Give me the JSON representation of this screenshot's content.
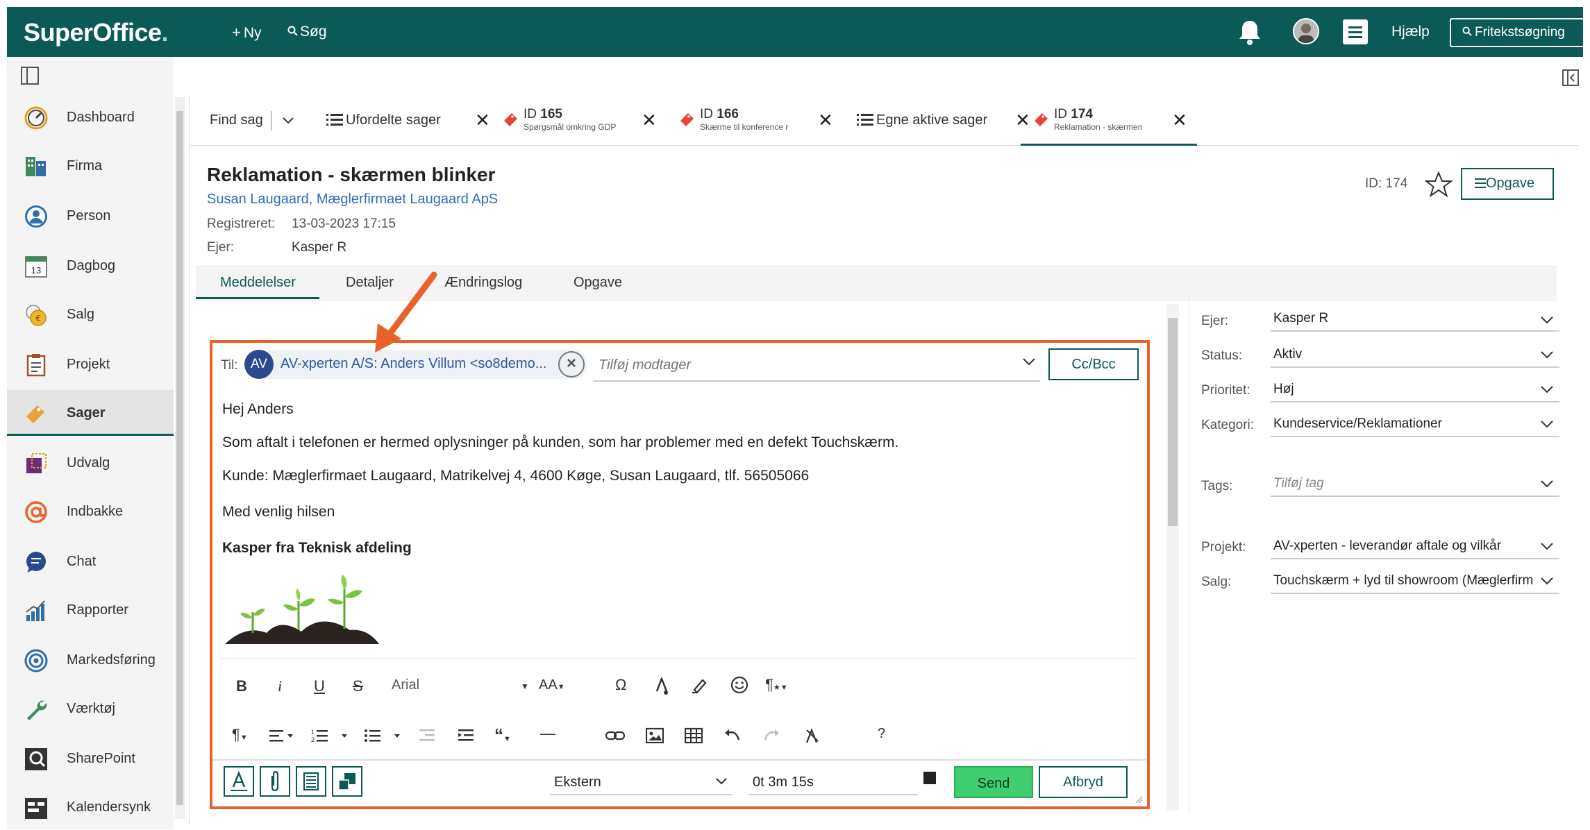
{
  "topbar": {
    "logo": "SuperOffice",
    "logo_dot": ".",
    "new": "Ny",
    "search": "Søg",
    "help": "Hjælp",
    "freetext": "Fritekstsøgning"
  },
  "sidebar": {
    "items": [
      {
        "label": "Dashboard"
      },
      {
        "label": "Firma"
      },
      {
        "label": "Person"
      },
      {
        "label": "Dagbog"
      },
      {
        "label": "Salg"
      },
      {
        "label": "Projekt"
      },
      {
        "label": "Sager"
      },
      {
        "label": "Udvalg"
      },
      {
        "label": "Indbakke"
      },
      {
        "label": "Chat"
      },
      {
        "label": "Rapporter"
      },
      {
        "label": "Markedsføring"
      },
      {
        "label": "Værktøj"
      },
      {
        "label": "SharePoint"
      },
      {
        "label": "Kalendersynk"
      }
    ],
    "calendar_day": "13"
  },
  "tabs": {
    "find": "Find sag",
    "t1": "Ufordelte sager",
    "t2_id": "ID",
    "t2_num": "165",
    "t2_sub": "Spørgsmål omkring GDP",
    "t3_id": "ID",
    "t3_num": "166",
    "t3_sub": "Skærme til konference r",
    "t4": "Egne aktive sager",
    "t5_id": "ID",
    "t5_num": "174",
    "t5_sub": "Reklamation - skærmen"
  },
  "case": {
    "title": "Reklamation - skærmen blinker",
    "contact": "Susan Laugaard, Mæglerfirmaet Laugaard ApS",
    "registered_label": "Registreret:",
    "registered_value": "13-03-2023 17:15",
    "owner_label": "Ejer:",
    "owner_value": "Kasper R",
    "id_text": "ID:  174",
    "opgave": "Opgave"
  },
  "subtabs": [
    "Meddelelser",
    "Detaljer",
    "Ændringslog",
    "Opgave"
  ],
  "editor": {
    "to_label": "Til:",
    "chip_initials": "AV",
    "chip_text": "AV-xperten A/S: Anders Villum <so8demo...",
    "recipient_placeholder": "Tilføj modtager",
    "ccbcc": "Cc/Bcc",
    "greeting": "Hej Anders",
    "line1": "Som aftalt i telefonen er hermed oplysninger på kunden, som har problemer med en defekt Touchskærm.",
    "line2": "Kunde: Mæglerfirmaet Laugaard, Matrikelvej 4, 4600 Køge, Susan Laugaard, tlf. 56505066",
    "closing": "Med venlig hilsen",
    "signature": "Kasper fra Teknisk afdeling",
    "font": "Arial",
    "visibility": "Ekstern",
    "timer": "0t 3m 15s",
    "send": "Send",
    "cancel": "Afbryd"
  },
  "details": {
    "owner_label": "Ejer:",
    "owner": "Kasper R",
    "status_label": "Status:",
    "status": "Aktiv",
    "priority_label": "Prioritet:",
    "priority": "Høj",
    "category_label": "Kategori:",
    "category": "Kundeservice/Reklamationer",
    "tags_label": "Tags:",
    "tags_placeholder": "Tilføj tag",
    "project_label": "Projekt:",
    "project": "AV-xperten - leverandør aftale og vilkår",
    "sale_label": "Salg:",
    "sale": "Touchskærm + lyd til showroom (Mæglerfirm"
  },
  "colors": {
    "topbar": "#0b5a55",
    "highlight": "#e8632b",
    "send": "#3fcf6e",
    "link": "#2a6ebb"
  }
}
